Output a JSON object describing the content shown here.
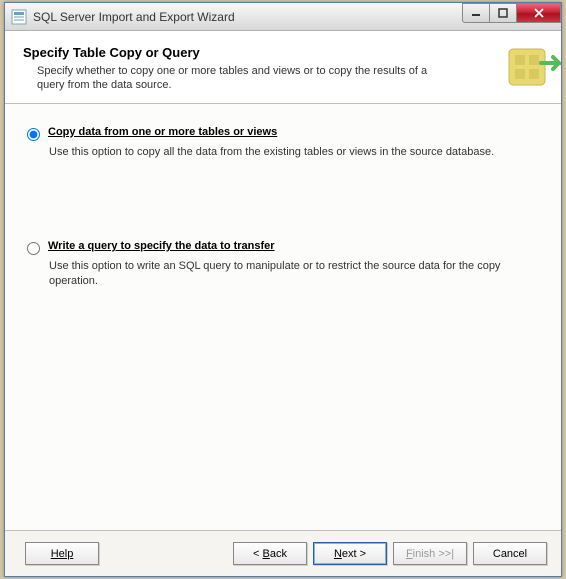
{
  "titlebar": {
    "text": "SQL Server Import and Export Wizard"
  },
  "header": {
    "title": "Specify Table Copy or Query",
    "subtitle": "Specify whether to copy one or more tables and views or to copy the results of a query from the data source."
  },
  "options": {
    "copy": {
      "label": "Copy data from one or more tables or views",
      "desc": "Use this option to copy all the data from the existing tables or views in the source database.",
      "selected": true
    },
    "query": {
      "label": "Write a query to specify the data to transfer",
      "desc": "Use this option to write an SQL query to manipulate or to restrict the source data for the copy operation.",
      "selected": false
    }
  },
  "buttons": {
    "help": "Help",
    "back": "< Back",
    "next": "Next >",
    "finish": "Finish >>|",
    "cancel": "Cancel"
  }
}
